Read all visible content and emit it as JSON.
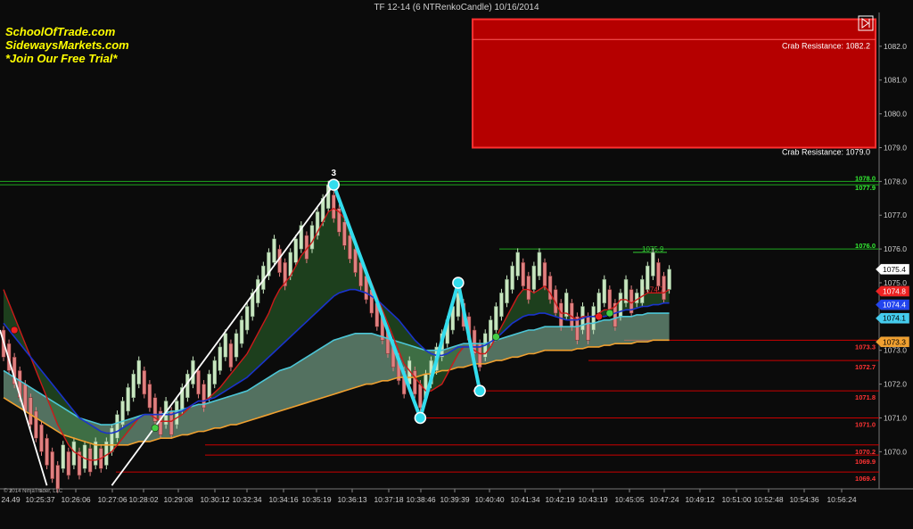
{
  "window": {
    "title": "TF 12-14 (6 NTRenkoCandle)  10/16/2014",
    "copyright": "© 2014 NinjaTrader, LLC"
  },
  "branding": {
    "line1": "SchoolOfTrade.com",
    "line2": "SidewaysMarkets.com",
    "line3": "*Join Our Free Trial*",
    "color": "#ffff00"
  },
  "colors": {
    "background": "#0b0b0b",
    "bull_candle": "#c8e6c0",
    "bear_candle": "#e08080",
    "zigzag": "#33dded",
    "zone_fill": "#c40000",
    "green_level": "#1faa1f",
    "red_level": "#cc0000",
    "blue_ma": "#1a33cc",
    "orange_ma": "#f0a030",
    "cyan_ma": "#4cc6d6"
  },
  "chart_data": {
    "type": "candlestick",
    "ylim": [
      1068.9,
      1083.0
    ],
    "y_ticks": [
      1070.0,
      1071.0,
      1072.0,
      1073.0,
      1074.0,
      1075.0,
      1076.0,
      1077.0,
      1078.0,
      1079.0,
      1080.0,
      1081.0,
      1082.0
    ],
    "x_ticks": [
      "24.49",
      "10:25:37",
      "10:26:06",
      "10:27:06",
      "10:28:02",
      "10:29:08",
      "10:30:12",
      "10:32:34",
      "10:34:16",
      "10:35:19",
      "10:36:13",
      "10:37:18",
      "10:38:46",
      "10:39:39",
      "10:40:40",
      "10:41:34",
      "10:42:19",
      "10:43:19",
      "10:45:05",
      "10:47:24",
      "10:49:12",
      "10:51:00",
      "10:52:48",
      "10:54:36",
      "10:56:24"
    ],
    "resistance_zone": {
      "top": 1082.8,
      "bottom": 1079.0,
      "mid": 1082.2,
      "labels": [
        "Crab Resistance: 1082.2",
        "Crab Resistance: 1079.0"
      ]
    },
    "green_levels": [
      {
        "value": 1078.0,
        "label": "1078.0"
      },
      {
        "value": 1077.9,
        "label": "1077.9"
      },
      {
        "value": 1076.0,
        "label": "1076.0"
      }
    ],
    "red_levels": [
      {
        "value": 1073.3,
        "label": "1073.3"
      },
      {
        "value": 1072.7,
        "label": "1072.7"
      },
      {
        "value": 1071.8,
        "label": "1071.8"
      },
      {
        "value": 1071.0,
        "label": "1071.0"
      },
      {
        "value": 1070.2,
        "label": "1070.2"
      },
      {
        "value": 1069.9,
        "label": "1069.9"
      },
      {
        "value": 1069.4,
        "label": "1069.4"
      }
    ],
    "price_badges": [
      {
        "value": 1075.4,
        "label": "1075.4",
        "color": "#ffffff",
        "text": "#000000"
      },
      {
        "value": 1074.8,
        "label": "1074.8",
        "color": "#ee2222",
        "text": "#ffffff"
      },
      {
        "value": 1074.4,
        "label": "1074.4",
        "color": "#2244ee",
        "text": "#ffffff"
      },
      {
        "value": 1074.1,
        "label": "1074.1",
        "color": "#44ccee",
        "text": "#000000"
      },
      {
        "value": 1073.3,
        "label": "1073.3",
        "color": "#f0a030",
        "text": "#000000"
      }
    ],
    "inline_labels": [
      {
        "label": "1075.9",
        "value": 1075.9,
        "color": "#33cc33"
      },
      {
        "label": "1074.7",
        "value": 1074.7,
        "color": "#ee3333"
      }
    ],
    "pattern": {
      "label": "3",
      "points": [
        {
          "bar": 20,
          "value": 1069.0
        },
        {
          "bar": 61,
          "value": 1077.9
        },
        {
          "bar": 77,
          "value": 1071.0
        },
        {
          "bar": 84,
          "value": 1075.0
        },
        {
          "bar": 88,
          "value": 1071.8
        }
      ]
    },
    "signal_dots": [
      {
        "bar": 2,
        "value": 1073.6,
        "color": "#ee2222"
      },
      {
        "bar": 28,
        "value": 1070.7,
        "color": "#44cc44"
      },
      {
        "bar": 91,
        "value": 1073.4,
        "color": "#44cc44"
      },
      {
        "bar": 110,
        "value": 1074.0,
        "color": "#ee2222"
      },
      {
        "bar": 112,
        "value": 1074.1,
        "color": "#44cc44"
      }
    ],
    "candles": [
      {
        "o": 1073.6,
        "c": 1072.8
      },
      {
        "o": 1073.2,
        "c": 1072.4
      },
      {
        "o": 1072.8,
        "c": 1072.0
      },
      {
        "o": 1072.4,
        "c": 1071.6
      },
      {
        "o": 1072.0,
        "c": 1071.2
      },
      {
        "o": 1071.6,
        "c": 1070.8
      },
      {
        "o": 1071.2,
        "c": 1070.4
      },
      {
        "o": 1070.8,
        "c": 1070.0
      },
      {
        "o": 1070.4,
        "c": 1069.6
      },
      {
        "o": 1070.0,
        "c": 1069.2
      },
      {
        "o": 1069.6,
        "c": 1068.9
      },
      {
        "o": 1069.5,
        "c": 1070.2
      },
      {
        "o": 1070.0,
        "c": 1069.3
      },
      {
        "o": 1069.6,
        "c": 1070.3
      },
      {
        "o": 1070.0,
        "c": 1069.3
      },
      {
        "o": 1069.5,
        "c": 1070.2
      },
      {
        "o": 1070.1,
        "c": 1069.4
      },
      {
        "o": 1069.6,
        "c": 1070.3
      },
      {
        "o": 1070.1,
        "c": 1069.5
      },
      {
        "o": 1069.6,
        "c": 1070.3
      },
      {
        "o": 1070.0,
        "c": 1070.7
      },
      {
        "o": 1070.4,
        "c": 1071.1
      },
      {
        "o": 1070.8,
        "c": 1071.5
      },
      {
        "o": 1071.2,
        "c": 1071.9
      },
      {
        "o": 1071.6,
        "c": 1072.3
      },
      {
        "o": 1072.0,
        "c": 1072.7
      },
      {
        "o": 1072.4,
        "c": 1071.7
      },
      {
        "o": 1072.0,
        "c": 1071.3
      },
      {
        "o": 1071.6,
        "c": 1070.9
      },
      {
        "o": 1071.2,
        "c": 1070.5
      },
      {
        "o": 1070.8,
        "c": 1071.5
      },
      {
        "o": 1071.2,
        "c": 1070.5
      },
      {
        "o": 1070.8,
        "c": 1071.5
      },
      {
        "o": 1071.2,
        "c": 1071.9
      },
      {
        "o": 1071.6,
        "c": 1072.3
      },
      {
        "o": 1072.0,
        "c": 1072.7
      },
      {
        "o": 1072.4,
        "c": 1071.7
      },
      {
        "o": 1072.0,
        "c": 1071.3
      },
      {
        "o": 1071.6,
        "c": 1072.3
      },
      {
        "o": 1072.0,
        "c": 1072.7
      },
      {
        "o": 1072.4,
        "c": 1073.1
      },
      {
        "o": 1072.8,
        "c": 1073.5
      },
      {
        "o": 1073.2,
        "c": 1072.5
      },
      {
        "o": 1072.8,
        "c": 1073.5
      },
      {
        "o": 1073.2,
        "c": 1073.9
      },
      {
        "o": 1073.6,
        "c": 1074.3
      },
      {
        "o": 1074.0,
        "c": 1074.7
      },
      {
        "o": 1074.4,
        "c": 1075.1
      },
      {
        "o": 1074.8,
        "c": 1075.5
      },
      {
        "o": 1075.2,
        "c": 1075.9
      },
      {
        "o": 1075.6,
        "c": 1076.3
      },
      {
        "o": 1076.0,
        "c": 1075.3
      },
      {
        "o": 1075.6,
        "c": 1074.9
      },
      {
        "o": 1075.2,
        "c": 1075.9
      },
      {
        "o": 1075.6,
        "c": 1076.3
      },
      {
        "o": 1076.0,
        "c": 1076.7
      },
      {
        "o": 1076.4,
        "c": 1075.7
      },
      {
        "o": 1076.0,
        "c": 1076.7
      },
      {
        "o": 1076.4,
        "c": 1077.1
      },
      {
        "o": 1076.8,
        "c": 1077.5
      },
      {
        "o": 1077.2,
        "c": 1077.9
      },
      {
        "o": 1077.6,
        "c": 1076.9
      },
      {
        "o": 1077.2,
        "c": 1076.5
      },
      {
        "o": 1076.8,
        "c": 1076.1
      },
      {
        "o": 1076.4,
        "c": 1075.7
      },
      {
        "o": 1076.0,
        "c": 1075.3
      },
      {
        "o": 1075.6,
        "c": 1074.9
      },
      {
        "o": 1075.2,
        "c": 1074.5
      },
      {
        "o": 1074.8,
        "c": 1074.1
      },
      {
        "o": 1074.4,
        "c": 1073.7
      },
      {
        "o": 1074.0,
        "c": 1073.3
      },
      {
        "o": 1073.6,
        "c": 1072.9
      },
      {
        "o": 1073.2,
        "c": 1072.5
      },
      {
        "o": 1072.8,
        "c": 1072.1
      },
      {
        "o": 1072.4,
        "c": 1071.7
      },
      {
        "o": 1072.0,
        "c": 1072.7
      },
      {
        "o": 1072.4,
        "c": 1071.7
      },
      {
        "o": 1072.0,
        "c": 1071.3
      },
      {
        "o": 1071.6,
        "c": 1072.3
      },
      {
        "o": 1072.0,
        "c": 1072.7
      },
      {
        "o": 1072.4,
        "c": 1073.1
      },
      {
        "o": 1072.8,
        "c": 1073.5
      },
      {
        "o": 1073.2,
        "c": 1073.9
      },
      {
        "o": 1073.6,
        "c": 1074.3
      },
      {
        "o": 1074.0,
        "c": 1074.7
      },
      {
        "o": 1074.4,
        "c": 1073.7
      },
      {
        "o": 1074.0,
        "c": 1073.3
      },
      {
        "o": 1073.6,
        "c": 1072.9
      },
      {
        "o": 1073.2,
        "c": 1072.5
      },
      {
        "o": 1072.8,
        "c": 1073.5
      },
      {
        "o": 1073.2,
        "c": 1073.9
      },
      {
        "o": 1073.6,
        "c": 1074.3
      },
      {
        "o": 1074.0,
        "c": 1074.7
      },
      {
        "o": 1074.4,
        "c": 1075.1
      },
      {
        "o": 1074.8,
        "c": 1075.5
      },
      {
        "o": 1075.2,
        "c": 1075.9
      },
      {
        "o": 1075.6,
        "c": 1074.9
      },
      {
        "o": 1075.2,
        "c": 1074.5
      },
      {
        "o": 1074.8,
        "c": 1075.5
      },
      {
        "o": 1075.2,
        "c": 1075.9
      },
      {
        "o": 1075.6,
        "c": 1074.9
      },
      {
        "o": 1075.2,
        "c": 1074.5
      },
      {
        "o": 1074.8,
        "c": 1074.1
      },
      {
        "o": 1074.4,
        "c": 1073.7
      },
      {
        "o": 1074.0,
        "c": 1074.7
      },
      {
        "o": 1074.4,
        "c": 1073.7
      },
      {
        "o": 1074.0,
        "c": 1073.3
      },
      {
        "o": 1073.6,
        "c": 1074.3
      },
      {
        "o": 1074.0,
        "c": 1073.3
      },
      {
        "o": 1073.6,
        "c": 1074.3
      },
      {
        "o": 1074.0,
        "c": 1074.7
      },
      {
        "o": 1074.4,
        "c": 1075.1
      },
      {
        "o": 1074.8,
        "c": 1074.1
      },
      {
        "o": 1074.4,
        "c": 1073.7
      },
      {
        "o": 1074.0,
        "c": 1074.7
      },
      {
        "o": 1074.4,
        "c": 1075.1
      },
      {
        "o": 1074.8,
        "c": 1074.1
      },
      {
        "o": 1074.4,
        "c": 1074.7
      },
      {
        "o": 1074.4,
        "c": 1075.1
      },
      {
        "o": 1074.8,
        "c": 1075.5
      },
      {
        "o": 1075.2,
        "c": 1075.9
      },
      {
        "o": 1075.6,
        "c": 1074.9
      },
      {
        "o": 1075.2,
        "c": 1074.5
      },
      {
        "o": 1074.8,
        "c": 1075.4
      }
    ],
    "ma_cyan": [
      1072.4,
      1072.3,
      1072.2,
      1072.1,
      1072.0,
      1071.9,
      1071.8,
      1071.7,
      1071.6,
      1071.5,
      1071.4,
      1071.3,
      1071.2,
      1071.1,
      1071.0,
      1070.95,
      1070.9,
      1070.85,
      1070.8,
      1070.8,
      1070.8,
      1070.85,
      1070.9,
      1070.95,
      1071.0,
      1071.05,
      1071.1,
      1071.1,
      1071.1,
      1071.1,
      1071.15,
      1071.2,
      1071.2,
      1071.25,
      1071.3,
      1071.35,
      1071.4,
      1071.4,
      1071.45,
      1071.5,
      1071.55,
      1071.6,
      1071.65,
      1071.7,
      1071.75,
      1071.8,
      1071.9,
      1072.0,
      1072.1,
      1072.2,
      1072.3,
      1072.4,
      1072.45,
      1072.5,
      1072.6,
      1072.7,
      1072.8,
      1072.9,
      1073.0,
      1073.1,
      1073.2,
      1073.3,
      1073.35,
      1073.4,
      1073.45,
      1073.5,
      1073.5,
      1073.5,
      1073.5,
      1073.45,
      1073.4,
      1073.35,
      1073.3,
      1073.25,
      1073.2,
      1073.15,
      1073.1,
      1073.05,
      1073.0,
      1073.0,
      1073.0,
      1073.0,
      1073.05,
      1073.1,
      1073.15,
      1073.2,
      1073.2,
      1073.2,
      1073.2,
      1073.2,
      1073.25,
      1073.3,
      1073.35,
      1073.4,
      1073.45,
      1073.5,
      1073.55,
      1073.6,
      1073.6,
      1073.65,
      1073.7,
      1073.7,
      1073.7,
      1073.7,
      1073.7,
      1073.7,
      1073.7,
      1073.75,
      1073.8,
      1073.8,
      1073.85,
      1073.9,
      1073.9,
      1073.95,
      1074.0,
      1074.0,
      1074.0,
      1074.05,
      1074.05,
      1074.1,
      1074.1,
      1074.1,
      1074.1,
      1074.1
    ],
    "ma_orange": [
      1071.6,
      1071.5,
      1071.4,
      1071.3,
      1071.2,
      1071.1,
      1071.0,
      1070.9,
      1070.8,
      1070.7,
      1070.6,
      1070.5,
      1070.45,
      1070.4,
      1070.35,
      1070.3,
      1070.25,
      1070.2,
      1070.2,
      1070.2,
      1070.2,
      1070.2,
      1070.2,
      1070.2,
      1070.25,
      1070.3,
      1070.3,
      1070.3,
      1070.35,
      1070.4,
      1070.4,
      1070.4,
      1070.45,
      1070.5,
      1070.5,
      1070.55,
      1070.6,
      1070.6,
      1070.65,
      1070.7,
      1070.7,
      1070.75,
      1070.8,
      1070.8,
      1070.85,
      1070.9,
      1070.95,
      1071.0,
      1071.05,
      1071.1,
      1071.15,
      1071.2,
      1071.25,
      1071.3,
      1071.35,
      1071.4,
      1071.45,
      1071.5,
      1071.55,
      1071.6,
      1071.65,
      1071.7,
      1071.75,
      1071.8,
      1071.85,
      1071.9,
      1071.95,
      1072.0,
      1072.0,
      1072.05,
      1072.1,
      1072.1,
      1072.15,
      1072.2,
      1072.2,
      1072.2,
      1072.2,
      1072.25,
      1072.3,
      1072.3,
      1072.35,
      1072.4,
      1072.4,
      1072.45,
      1072.5,
      1072.5,
      1072.55,
      1072.6,
      1072.6,
      1072.6,
      1072.65,
      1072.7,
      1072.7,
      1072.75,
      1072.8,
      1072.8,
      1072.85,
      1072.9,
      1072.9,
      1072.95,
      1073.0,
      1073.0,
      1073.0,
      1073.0,
      1073.0,
      1073.0,
      1073.05,
      1073.05,
      1073.1,
      1073.1,
      1073.1,
      1073.15,
      1073.15,
      1073.2,
      1073.2,
      1073.2,
      1073.2,
      1073.25,
      1073.25,
      1073.25,
      1073.3,
      1073.3,
      1073.3,
      1073.3
    ],
    "ma_blue": [
      1073.8,
      1073.6,
      1073.4,
      1073.2,
      1073.0,
      1072.8,
      1072.6,
      1072.4,
      1072.2,
      1072.0,
      1071.8,
      1071.6,
      1071.4,
      1071.2,
      1071.0,
      1070.9,
      1070.8,
      1070.7,
      1070.6,
      1070.55,
      1070.55,
      1070.6,
      1070.7,
      1070.8,
      1070.9,
      1071.0,
      1071.1,
      1071.1,
      1071.1,
      1071.1,
      1071.1,
      1071.1,
      1071.15,
      1071.2,
      1071.3,
      1071.4,
      1071.5,
      1071.5,
      1071.55,
      1071.6,
      1071.7,
      1071.8,
      1071.9,
      1072.0,
      1072.1,
      1072.2,
      1072.35,
      1072.5,
      1072.65,
      1072.8,
      1072.95,
      1073.1,
      1073.25,
      1073.4,
      1073.55,
      1073.7,
      1073.85,
      1074.0,
      1074.15,
      1074.3,
      1074.45,
      1074.6,
      1074.7,
      1074.75,
      1074.8,
      1074.8,
      1074.75,
      1074.7,
      1074.6,
      1074.5,
      1074.35,
      1074.2,
      1074.05,
      1073.9,
      1073.7,
      1073.5,
      1073.3,
      1073.15,
      1073.0,
      1072.9,
      1072.85,
      1072.85,
      1072.9,
      1073.0,
      1073.1,
      1073.1,
      1073.1,
      1073.1,
      1073.1,
      1073.15,
      1073.25,
      1073.35,
      1073.5,
      1073.65,
      1073.8,
      1073.9,
      1074.0,
      1074.05,
      1074.05,
      1074.1,
      1074.1,
      1074.05,
      1074.0,
      1073.95,
      1073.9,
      1073.9,
      1073.9,
      1073.95,
      1074.0,
      1074.0,
      1074.0,
      1074.0,
      1074.05,
      1074.1,
      1074.15,
      1074.2,
      1074.2,
      1074.25,
      1074.3,
      1074.3,
      1074.35,
      1074.35,
      1074.4,
      1074.4
    ],
    "ma_red": [
      1074.8,
      1074.4,
      1074.0,
      1073.6,
      1073.2,
      1072.8,
      1072.4,
      1072.0,
      1071.6,
      1071.2,
      1070.8,
      1070.5,
      1070.2,
      1070.0,
      1069.9,
      1069.8,
      1069.75,
      1069.75,
      1069.8,
      1069.9,
      1070.0,
      1070.2,
      1070.4,
      1070.6,
      1070.8,
      1071.0,
      1071.1,
      1071.1,
      1071.0,
      1070.9,
      1070.9,
      1070.9,
      1071.0,
      1071.1,
      1071.25,
      1071.4,
      1071.5,
      1071.5,
      1071.6,
      1071.75,
      1071.9,
      1072.1,
      1072.3,
      1072.5,
      1072.7,
      1072.9,
      1073.2,
      1073.5,
      1073.8,
      1074.1,
      1074.5,
      1074.8,
      1075.0,
      1075.2,
      1075.5,
      1075.8,
      1076.0,
      1076.2,
      1076.5,
      1076.8,
      1077.1,
      1077.2,
      1077.1,
      1076.9,
      1076.6,
      1076.2,
      1075.8,
      1075.4,
      1075.0,
      1074.6,
      1074.2,
      1073.8,
      1073.4,
      1073.0,
      1072.6,
      1072.4,
      1072.2,
      1072.0,
      1071.8,
      1071.8,
      1071.9,
      1072.0,
      1072.3,
      1072.6,
      1072.9,
      1073.1,
      1073.1,
      1073.0,
      1072.9,
      1072.9,
      1073.1,
      1073.4,
      1073.7,
      1074.0,
      1074.3,
      1074.6,
      1074.8,
      1074.8,
      1074.7,
      1074.8,
      1074.9,
      1074.7,
      1074.4,
      1074.1,
      1074.1,
      1074.0,
      1073.9,
      1074.0,
      1074.0,
      1074.0,
      1074.1,
      1074.2,
      1074.2,
      1074.3,
      1074.5,
      1074.5,
      1074.4,
      1074.5,
      1074.6,
      1074.7,
      1074.7,
      1074.7,
      1074.7,
      1074.8
    ]
  }
}
